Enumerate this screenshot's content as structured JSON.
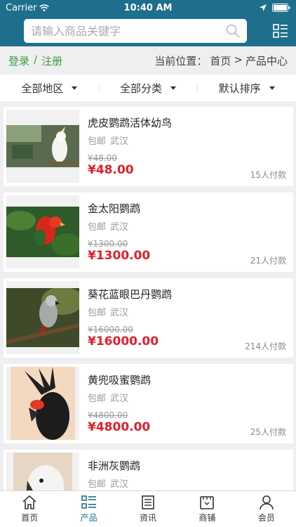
{
  "status": {
    "carrier": "Carrier",
    "time": "10:40 AM"
  },
  "search": {
    "placeholder": "请输入商品关键字"
  },
  "auth": {
    "login": "登录",
    "separator": "/",
    "register": "注册"
  },
  "breadcrumb": {
    "label": "当前位置：",
    "home": "首页",
    "arrow": ">",
    "current": "产品中心"
  },
  "filters": [
    "全部地区",
    "全部分类",
    "默认排序"
  ],
  "products": [
    {
      "title": "虎皮鹦鹉活体幼鸟",
      "shipping": "包邮",
      "city": "武汉",
      "old_price": "¥48.00",
      "price": "¥48.00",
      "sold": "15人付款"
    },
    {
      "title": "金太阳鹦鹉",
      "shipping": "包邮",
      "city": "武汉",
      "old_price": "¥1300.00",
      "price": "¥1300.00",
      "sold": "21人付款"
    },
    {
      "title": "葵花蓝眼巴丹鹦鹉",
      "shipping": "包邮",
      "city": "武汉",
      "old_price": "¥16000.00",
      "price": "¥16000.00",
      "sold": "214人付款"
    },
    {
      "title": "黄兜吸蜜鹦鹉",
      "shipping": "包邮",
      "city": "武汉",
      "old_price": "¥4800.00",
      "price": "¥4800.00",
      "sold": "25人付款"
    },
    {
      "title": "非洲灰鹦鹉",
      "shipping": "包邮",
      "city": "武汉",
      "old_price": "",
      "price": "",
      "sold": ""
    }
  ],
  "tabs": [
    {
      "label": "首页",
      "icon": "home-icon"
    },
    {
      "label": "产品",
      "icon": "list-icon"
    },
    {
      "label": "资讯",
      "icon": "news-icon"
    },
    {
      "label": "商铺",
      "icon": "store-icon"
    },
    {
      "label": "会员",
      "icon": "user-icon"
    }
  ],
  "colors": {
    "primary": "#1d6f8c",
    "price": "#e0202a",
    "green": "#3aa03a"
  }
}
